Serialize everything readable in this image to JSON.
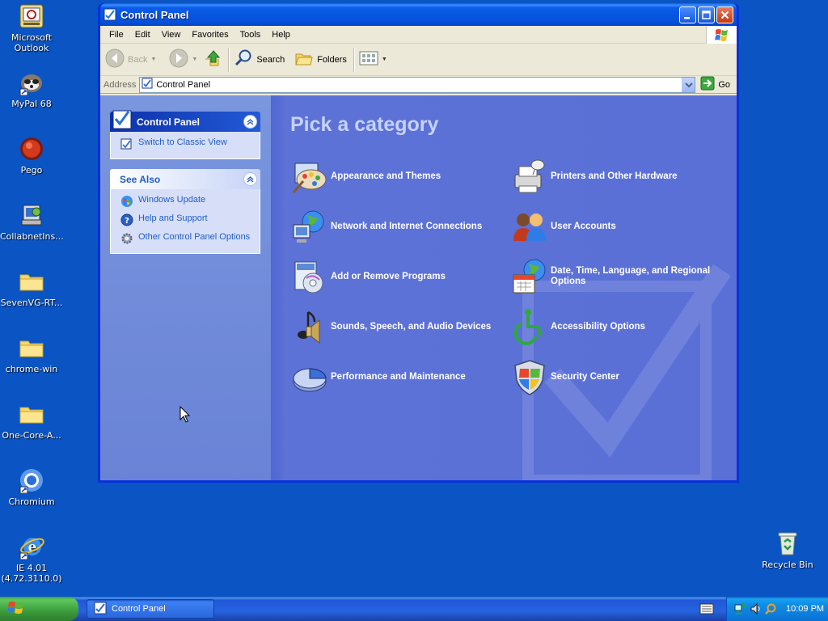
{
  "desktop": {
    "icons": [
      {
        "label_lines": [
          "Microsoft",
          "Outlook"
        ],
        "icon": "outlook-icon"
      },
      {
        "label_lines": [
          "MyPal 68"
        ],
        "icon": "mypal-icon"
      },
      {
        "label_lines": [
          "Pego"
        ],
        "icon": "pego-icon"
      },
      {
        "label_lines": [
          "CollabnetIns..."
        ],
        "icon": "installer-icon"
      },
      {
        "label_lines": [
          "SevenVG-RT..."
        ],
        "icon": "folder-icon"
      },
      {
        "label_lines": [
          "chrome-win"
        ],
        "icon": "folder-icon"
      },
      {
        "label_lines": [
          "One-Core-A..."
        ],
        "icon": "folder-icon"
      },
      {
        "label_lines": [
          "Chromium"
        ],
        "icon": "chromium-icon"
      },
      {
        "label_lines": [
          "IE 4.01",
          "(4.72.3110.0)"
        ],
        "icon": "ie-icon"
      }
    ],
    "recycle_bin": {
      "label": "Recycle Bin",
      "icon": "recycle-bin-icon"
    }
  },
  "window": {
    "title": "Control Panel",
    "menu": [
      "File",
      "Edit",
      "View",
      "Favorites",
      "Tools",
      "Help"
    ],
    "toolbar": {
      "back": "Back",
      "search": "Search",
      "folders": "Folders"
    },
    "address": {
      "label": "Address",
      "value": "Control Panel",
      "go": "Go"
    },
    "taskpane": {
      "control_panel": {
        "title": "Control Panel",
        "links": [
          "Switch to Classic View"
        ]
      },
      "see_also": {
        "title": "See Also",
        "links": [
          "Windows Update",
          "Help and Support",
          "Other Control Panel Options"
        ]
      }
    },
    "main": {
      "heading": "Pick a category",
      "categories": [
        {
          "label": "Appearance and Themes",
          "icon": "appearance-themes-icon"
        },
        {
          "label": "Printers and Other Hardware",
          "icon": "printers-hardware-icon"
        },
        {
          "label": "Network and Internet Connections",
          "icon": "network-internet-icon"
        },
        {
          "label": "User Accounts",
          "icon": "user-accounts-icon"
        },
        {
          "label": "Add or Remove Programs",
          "icon": "add-remove-programs-icon"
        },
        {
          "label": "Date, Time, Language, and Regional Options",
          "icon": "date-time-region-icon"
        },
        {
          "label": "Sounds, Speech, and Audio Devices",
          "icon": "sounds-audio-icon"
        },
        {
          "label": "Accessibility Options",
          "icon": "accessibility-icon"
        },
        {
          "label": "Performance and Maintenance",
          "icon": "performance-maintenance-icon"
        },
        {
          "label": "Security Center",
          "icon": "security-center-icon"
        }
      ]
    }
  },
  "taskbar": {
    "task_button": "Control Panel",
    "clock": "10:09 PM"
  },
  "colors": {
    "desktop": "#0a54c4",
    "main_pane": "#5b70d6",
    "taskpane": "#7a96df",
    "link": "#215dc6",
    "heading": "#c7d2fa"
  }
}
